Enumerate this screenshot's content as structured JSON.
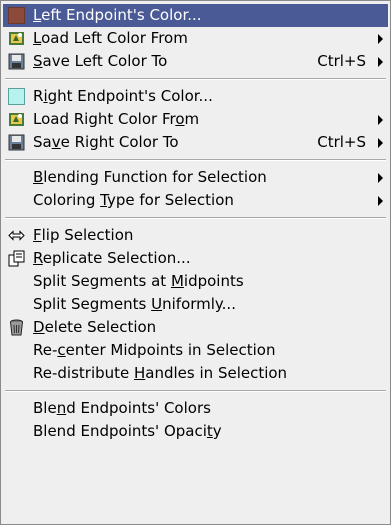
{
  "menu": {
    "items": [
      {
        "label": "Left Endpoint's Color...",
        "mnemonic": 0,
        "icon": "color-swatch-icon",
        "swatch": "#8b4a3a",
        "active": true
      },
      {
        "label": "Load Left Color From",
        "mnemonic": 0,
        "icon": "load-color-icon",
        "submenu": true
      },
      {
        "label": "Save Left Color To",
        "mnemonic": 0,
        "icon": "save-floppy-icon",
        "accel": "Ctrl+S",
        "submenu": true
      },
      {
        "label": "Right Endpoint's Color...",
        "mnemonic": 1,
        "icon": "color-swatch-icon",
        "swatch": "#b7f2ee"
      },
      {
        "label": "Load Right Color From",
        "mnemonic": 19,
        "icon": "load-color-icon",
        "submenu": true
      },
      {
        "label": "Save Right Color To",
        "mnemonic": 2,
        "icon": "save-floppy-icon",
        "accel": "Ctrl+S",
        "submenu": true
      },
      {
        "label": "Blending Function for Selection",
        "mnemonic": 0,
        "submenu": true
      },
      {
        "label": "Coloring Type for Selection",
        "mnemonic": 9,
        "submenu": true
      },
      {
        "label": "Flip Selection",
        "mnemonic": 0,
        "icon": "flip-arrows-icon"
      },
      {
        "label": "Replicate Selection...",
        "mnemonic": 0,
        "icon": "replicate-icon"
      },
      {
        "label": "Split Segments at Midpoints",
        "mnemonic": 18
      },
      {
        "label": "Split Segments Uniformly...",
        "mnemonic": 15
      },
      {
        "label": "Delete Selection",
        "mnemonic": 0,
        "icon": "trash-can-icon"
      },
      {
        "label": "Re-center Midpoints in Selection",
        "mnemonic": 3
      },
      {
        "label": "Re-distribute Handles in Selection",
        "mnemonic": 14
      },
      {
        "label": "Blend Endpoints' Colors",
        "mnemonic": 3
      },
      {
        "label": "Blend Endpoints' Opacity",
        "mnemonic": 22
      }
    ]
  }
}
